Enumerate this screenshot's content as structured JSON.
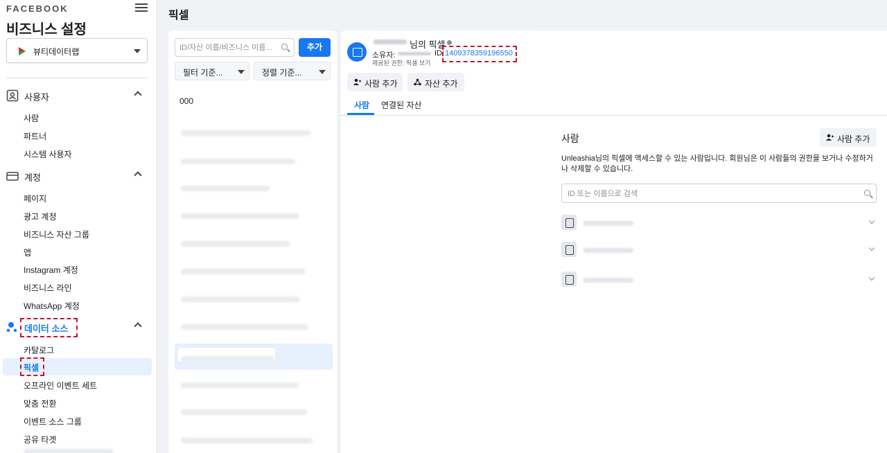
{
  "sidebar": {
    "brand": "FACEBOOK",
    "title": "비즈니스 설정",
    "account_name": "뷰티데이터랩",
    "sections": {
      "users": {
        "label": "사용자",
        "items": [
          "사람",
          "파트너",
          "시스템 사용자"
        ]
      },
      "accounts": {
        "label": "계정",
        "items": [
          "페이지",
          "광고 계정",
          "비즈니스 자산 그룹",
          "앱",
          "Instagram 계정",
          "비즈니스 라인",
          "WhatsApp 계정"
        ]
      },
      "data_sources": {
        "label": "데이터 소스",
        "items": [
          "카탈로그",
          "픽셀",
          "오프라인 이벤트 세트",
          "맞춤 전환",
          "이벤트 소스 그룹",
          "공유 타겟"
        ]
      }
    }
  },
  "page": {
    "title": "픽셀"
  },
  "list_panel": {
    "search_placeholder": "ID/자산 이름/비즈니스 이름...",
    "add_label": "추가",
    "filter_label": "필터 기준...",
    "sort_label": "정렬 기준...",
    "first_item": "000"
  },
  "detail": {
    "pixel_name_suffix": "님의 픽셀",
    "owner_label": "소유자:",
    "id_label": "ID:",
    "id_value": "1409378359196550",
    "permission_label": "제공된 권한: 픽셀 보기",
    "add_people_label": "사람 추가",
    "add_asset_label": "자산 추가",
    "tabs": [
      "사람",
      "연결된 자산"
    ],
    "people_title": "사람",
    "people_add_label": "사람 추가",
    "people_description": "Unleashia님의 픽셀에 액세스할 수 있는 사람입니다. 회원님은 이 사람들의 권한을 보거나 수정하거나 삭제할 수 있습니다.",
    "people_search_placeholder": "ID 또는 이름으로 검색"
  },
  "colors": {
    "accent": "#1877f2",
    "highlight_box": "#c8102e"
  }
}
